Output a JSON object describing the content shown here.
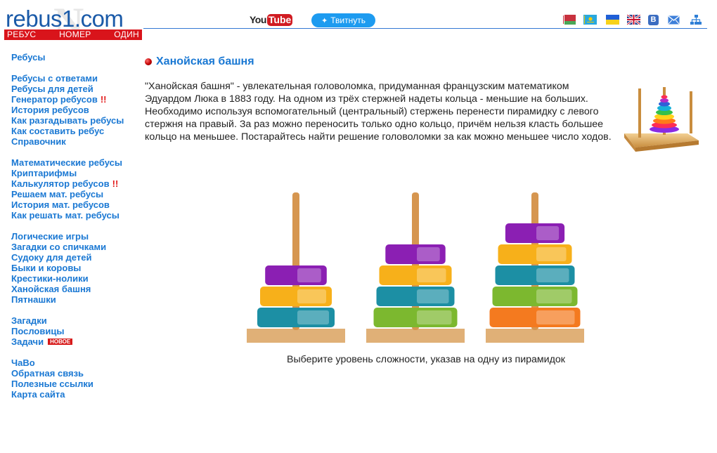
{
  "header": {
    "logo": {
      "site": "rebus1.com",
      "letter": "N",
      "tagline": [
        "РЕБУС",
        "НОМЕР",
        "ОДИН"
      ]
    },
    "youtube": {
      "you": "You",
      "tube": "Tube"
    },
    "tweet_label": "Твитнуть",
    "icons": [
      "flag-belarus-icon",
      "flag-kazakhstan-icon",
      "flag-ukraine-icon",
      "flag-uk-icon",
      "vk-icon",
      "mail-icon",
      "sitemap-icon"
    ],
    "vk_letter": "В"
  },
  "sidebar": {
    "groups": [
      {
        "items": [
          {
            "label": "Ребусы"
          }
        ]
      },
      {
        "items": [
          {
            "label": "Ребусы с ответами"
          },
          {
            "label": "Ребусы для детей"
          },
          {
            "label": "Генератор ребусов",
            "mark": "!!"
          },
          {
            "label": "История ребусов"
          },
          {
            "label": "Как разгадывать ребусы"
          },
          {
            "label": "Как составить ребус"
          },
          {
            "label": "Справочник"
          }
        ]
      },
      {
        "items": [
          {
            "label": "Математические ребусы"
          },
          {
            "label": "Криптарифмы"
          },
          {
            "label": "Калькулятор ребусов",
            "mark": "!!"
          },
          {
            "label": "Решаем мат. ребусы"
          },
          {
            "label": "История мат. ребусов"
          },
          {
            "label": "Как решать мат. ребусы"
          }
        ]
      },
      {
        "items": [
          {
            "label": "Логические игры"
          },
          {
            "label": "Загадки со спичками"
          },
          {
            "label": "Судоку для детей"
          },
          {
            "label": "Быки и коровы"
          },
          {
            "label": "Крестики-нолики"
          },
          {
            "label": "Ханойская башня"
          },
          {
            "label": "Пятнашки"
          }
        ]
      },
      {
        "items": [
          {
            "label": "Загадки"
          },
          {
            "label": "Пословицы"
          },
          {
            "label": "Задачи",
            "badge": "НОВОЕ"
          }
        ]
      },
      {
        "items": [
          {
            "label": "ЧаВо"
          },
          {
            "label": "Обратная связь"
          },
          {
            "label": "Полезные ссылки"
          },
          {
            "label": "Карта сайта"
          }
        ]
      }
    ]
  },
  "main": {
    "title": "Ханойская башня",
    "intro": "\"Ханойская башня\" - увлекательная головоломка, придуманная французским математиком Эдуардом Люка в 1883 году. На одном из трёх стержней надеты кольца - меньшие на больших. Необходимо используя вспомогательный (центральный) стержень перенести пирамидку с левого стержня на правый. За раз можно переносить только одно кольцо, причём нельзя класть большее кольцо на меньшее. Постарайтесь найти решение головоломки за как можно меньшее число ходов.",
    "pyramids": [
      {
        "level": "3",
        "rings": [
          {
            "color": "#8b1fb3"
          },
          {
            "color": "#f7b01a"
          },
          {
            "color": "#1c8fa4"
          }
        ]
      },
      {
        "level": "4",
        "rings": [
          {
            "color": "#8b1fb3"
          },
          {
            "color": "#f7b01a"
          },
          {
            "color": "#1c8fa4"
          },
          {
            "color": "#7cb82f"
          }
        ]
      },
      {
        "level": "5",
        "rings": [
          {
            "color": "#8b1fb3"
          },
          {
            "color": "#f7b01a"
          },
          {
            "color": "#1c8fa4"
          },
          {
            "color": "#7cb82f"
          },
          {
            "color": "#f47a1f"
          }
        ]
      }
    ],
    "hint": "Выберите уровень сложности, указав на одну из пирамидок"
  },
  "colors": {
    "link": "#1a78d3",
    "logo_red": "#d9141b",
    "logo_blue": "#1a5aa8",
    "twitter": "#1d9bf0",
    "wood": "#e0b077",
    "rod": "#d69650"
  }
}
